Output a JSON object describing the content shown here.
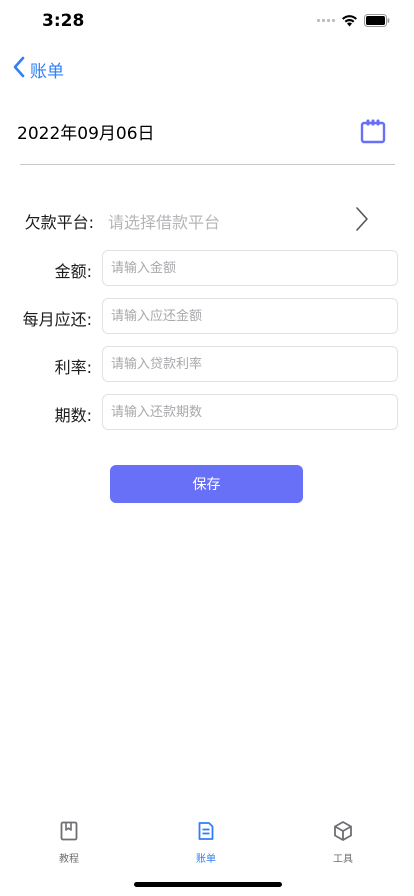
{
  "status_bar": {
    "time": "3:28"
  },
  "nav": {
    "back_label": "账单"
  },
  "date": {
    "value": "2022年09月06日"
  },
  "form": {
    "platform": {
      "label": "欠款平台:",
      "placeholder": "请选择借款平台"
    },
    "amount": {
      "label": "金额:",
      "placeholder": "请输入金额"
    },
    "monthly": {
      "label": "每月应还:",
      "placeholder": "请输入应还金额"
    },
    "rate": {
      "label": "利率:",
      "placeholder": "请输入贷款利率"
    },
    "periods": {
      "label": "期数:",
      "placeholder": "请输入还款期数"
    }
  },
  "save_label": "保存",
  "tabs": [
    {
      "label": "教程",
      "icon": "book-icon",
      "active": false
    },
    {
      "label": "账单",
      "icon": "bill-icon",
      "active": true
    },
    {
      "label": "工具",
      "icon": "box-icon",
      "active": false
    }
  ],
  "colors": {
    "accent": "#6870f7",
    "nav_blue": "#2f7ff6",
    "tab_inactive": "#6e6e73"
  }
}
